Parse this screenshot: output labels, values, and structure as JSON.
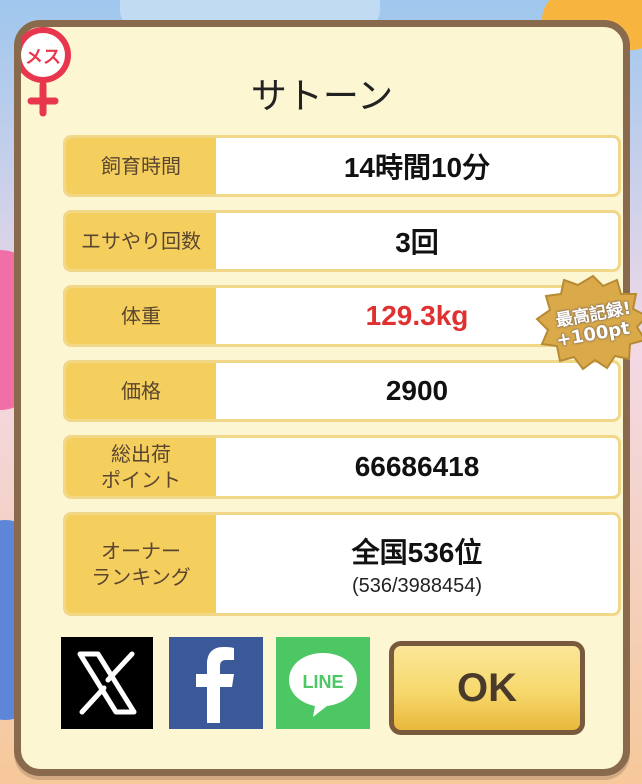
{
  "popup": {
    "title": "サトーン",
    "gender_badge": "メス",
    "rows": [
      {
        "label": "飼育時間",
        "value": "14時間10分"
      },
      {
        "label": "エサやり回数",
        "value": "3回"
      },
      {
        "label": "体重",
        "value": "129.3kg",
        "highlight": true
      },
      {
        "label": "価格",
        "value": "2900"
      },
      {
        "label_line1": "総出荷",
        "label_line2": "ポイント",
        "value": "66686418"
      },
      {
        "label_line1": "オーナー",
        "label_line2": "ランキング",
        "value": "全国536位",
        "sub": "(536/3988454)"
      }
    ],
    "record_badge": {
      "line1": "最高記録!",
      "line2": "+100pt"
    },
    "share": {
      "x_icon": "x-logo-icon",
      "facebook_icon": "facebook-f-icon",
      "line_label": "LINE"
    },
    "ok_label": "OK"
  },
  "colors": {
    "border": "#8a6a4d",
    "panel": "#fdf6d3",
    "label_bg": "#f5cf5e",
    "highlight": "#e03131",
    "facebook": "#3b5998",
    "line": "#4cc764",
    "gender": "#e8364e"
  }
}
